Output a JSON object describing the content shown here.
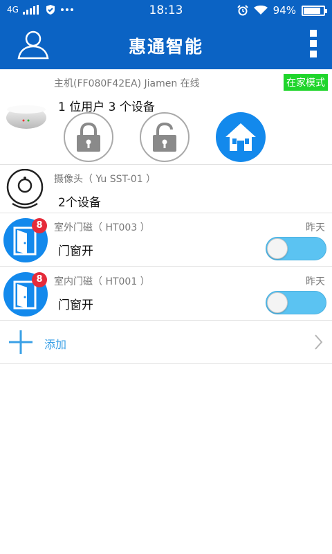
{
  "status_bar": {
    "network": "4G",
    "time": "18:13",
    "battery": "94%",
    "battery_level": 0.94
  },
  "app_bar": {
    "title": "惠通智能",
    "user_icon": "user-icon",
    "more_icon": "more-vertical-icon"
  },
  "hub": {
    "title": "主机(FF080F42EA) Jiamen 在线",
    "mode_badge": "在家模式",
    "summary": "1 位用户  3 个设备",
    "buttons": [
      {
        "name": "arm-lock-button",
        "icon": "lock-closed-icon"
      },
      {
        "name": "disarm-lock-button",
        "icon": "lock-open-icon"
      },
      {
        "name": "home-mode-button",
        "icon": "home-icon"
      }
    ]
  },
  "camera": {
    "title": "摄像头（ Yu SST-01 ）",
    "summary": "2个设备"
  },
  "sensors": [
    {
      "title": "室外门磁（  HT003 ）",
      "time": "昨天",
      "status": "门窗开",
      "badge": "8",
      "toggle_on": false
    },
    {
      "title": "室内门磁（  HT001 ）",
      "time": "昨天",
      "status": "门窗开",
      "badge": "8",
      "toggle_on": false
    }
  ],
  "add": {
    "label": "添加"
  },
  "colors": {
    "primary": "#0b63c4",
    "accent": "#1389ec",
    "mode_badge": "#1fd52b",
    "badge": "#e52b3a",
    "toggle": "#5bc3f2"
  }
}
